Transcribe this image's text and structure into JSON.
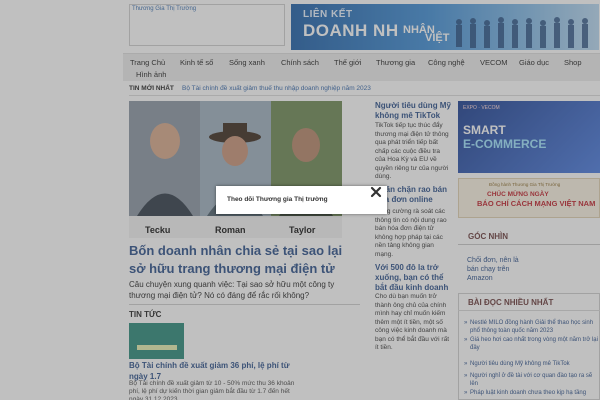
{
  "header": {
    "site_name": "Thương Gia Thị Trường",
    "banner": {
      "line1": "LIÊN KẾT",
      "line2": "DOANH NH",
      "line3": "ÂN",
      "line4": "VIỆT",
      "line5": "NHÂN",
      "line6": "Việt"
    }
  },
  "nav": {
    "items": [
      "Trang Chủ",
      "Kinh tế số",
      "Sống xanh",
      "Chính sách",
      "Thế giới",
      "Thương gia",
      "Công nghệ",
      "VECOM",
      "Giáo dục",
      "Shop",
      "Hình ảnh"
    ]
  },
  "ticker": {
    "label": "TIN MỚI NHẤT",
    "text": "Bộ Tài chính đề xuất giảm thuế thu nhập doanh nghiệp năm 2023"
  },
  "featured": {
    "names": [
      "Tecku",
      "Roman",
      "Taylor"
    ],
    "title": "Bốn doanh nhân chia sẻ tại sao lại sở hữu trang thương mại điện tử",
    "summary": "Câu chuyện xung quanh việc: Tại sao sở hữu một công ty thương mại điện tử? Nó có đáng để rắc rối không?"
  },
  "news_section": {
    "heading": "TIN TỨC",
    "item_title": "Bộ Tài chính đề xuất giảm 36 phí, lệ phí từ ngày 1.7",
    "item_summary": "Bộ Tài chính đề xuất giảm từ 10 - 50% mức thu 36 khoản phí, lệ phí dự kiến thời gian giảm bắt đầu từ 1.7 đến hết ngày 31.12.2023"
  },
  "middle": {
    "articles": [
      {
        "title": "Người tiêu dùng Mỹ không mê TikTok",
        "text": "TikTok tiếp tục thúc đẩy thương mại điện tử thông qua phát triển tiếp bất chấp các cuộc điều tra của Hoa Kỳ và EU về quyền riêng tư của người dùng."
      },
      {
        "title": "Ngăn chặn rao bán hóa đơn online",
        "text": "Cũng cường rà soát các thông tin có nội dung rao bán hóa đơn điện tử không hợp pháp tại các nền tảng không gian mạng."
      },
      {
        "title": "Với 500 đô la trở xuống, bạn có thể bắt đầu kinh doanh",
        "text": "Cho dù bạn muốn trở thành ông chủ của chính mình hay chỉ muốn kiếm thêm một ít tiền, một số công việc kinh doanh mà bạn có thể bắt đầu với rất ít tiền."
      }
    ]
  },
  "right": {
    "ad1": {
      "title1": "SMART",
      "title2": "E-COMMERCE",
      "logos": "EXPO · VECOM"
    },
    "ad2": {
      "line1": "CHÚC MỪNG NGÀY",
      "line2": "BÁO CHÍ CÁCH MẠNG VIỆT NAM",
      "line3": "Đồng hành Thương Gia Thị Trường"
    },
    "goc_nhin": {
      "heading": "GÓC NHÌN",
      "items": [
        "Chối đơn, nên là",
        "bán chạy trên",
        "Amazon"
      ]
    },
    "popular": {
      "heading": "BÀI ĐỌC NHIỀU NHẤT",
      "items": [
        "Nestlé MILO đồng hành Giải thể thao học sinh phổ thông toàn quốc năm 2023",
        "Giá heo hơi cao nhất trong vòng một năm trở lại đây",
        "Người tiêu dùng Mỹ không mê TikTok",
        "Người nghỉ ở đề tài với cơ quan đào tạo ra sẽ lên",
        "Pháp luật kinh doanh chưa theo kịp hạ tầng"
      ]
    }
  },
  "popup": {
    "title": "Theo dõi Thương gia Thị trường",
    "close_icon": "close-icon"
  }
}
